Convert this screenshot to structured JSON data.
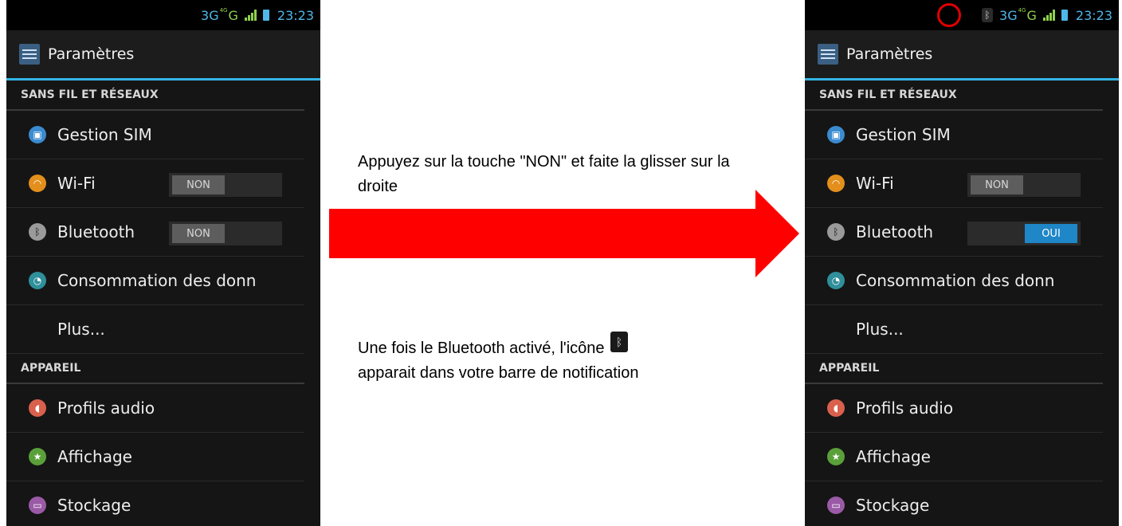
{
  "status_bar": {
    "network": "3G",
    "network_sub": "4G",
    "network_type": "G",
    "time": "23:23"
  },
  "app": {
    "title": "Paramètres"
  },
  "sections": {
    "wireless": "SANS FIL ET RÉSEAUX",
    "device": "APPAREIL"
  },
  "items": {
    "sim": "Gestion SIM",
    "wifi": "Wi-Fi",
    "bluetooth": "Bluetooth",
    "data_usage": "Consommation des donn",
    "more": "Plus...",
    "audio": "Profils audio",
    "display": "Affichage",
    "storage": "Stockage"
  },
  "toggles": {
    "off_label": "NON",
    "on_label": "OUI"
  },
  "colors": {
    "accent": "#33b5e5",
    "arrow": "#ff0000",
    "highlight": "#e00000",
    "toggle_on": "#1f86c7"
  },
  "icons": {
    "sim": "sim-icon",
    "wifi": "wifi-icon",
    "bluetooth": "bluetooth-icon",
    "data_usage": "data-usage-icon",
    "audio": "audio-icon",
    "display": "display-icon",
    "storage": "storage-icon"
  },
  "instructions": {
    "step1": "Appuyez sur la touche \"NON\" et faite la glisser sur la droite",
    "step2_before": "Une fois le Bluetooth activé, l'icône",
    "step2_after": "apparait dans votre barre de notification"
  }
}
